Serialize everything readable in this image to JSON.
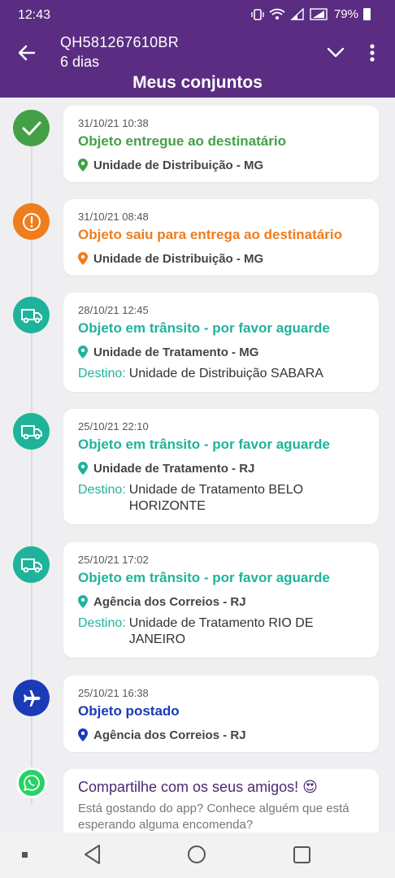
{
  "status_bar": {
    "time": "12:43",
    "battery": "79%"
  },
  "header": {
    "tracking_code": "QH581267610BR",
    "days": "6 dias",
    "title": "Meus conjuntos"
  },
  "colors": {
    "purple": "#5a2d82",
    "green": "#43a047",
    "orange": "#ef7d1c",
    "teal": "#1fb39b",
    "blue": "#1a3bb8",
    "whatsapp": "#25d366"
  },
  "destination_label": "Destino:",
  "events": [
    {
      "date": "31/10/21 10:38",
      "status": "Objeto entregue ao destinatário",
      "location": "Unidade de Distribuição - MG",
      "icon": "check-icon"
    },
    {
      "date": "31/10/21 08:48",
      "status": "Objeto saiu para entrega ao destinatário",
      "location": "Unidade de Distribuição - MG",
      "icon": "alert-icon"
    },
    {
      "date": "28/10/21 12:45",
      "status": "Objeto em trânsito - por favor aguarde",
      "location": "Unidade de Tratamento - MG",
      "destination": "Unidade de Distribuição SABARA",
      "icon": "truck-icon"
    },
    {
      "date": "25/10/21 22:10",
      "status": "Objeto em trânsito - por favor aguarde",
      "location": "Unidade de Tratamento - RJ",
      "destination": "Unidade de Tratamento BELO HORIZONTE",
      "icon": "truck-icon"
    },
    {
      "date": "25/10/21 17:02",
      "status": "Objeto em trânsito - por favor aguarde",
      "location": "Agência dos Correios - RJ",
      "destination": "Unidade de Tratamento RIO DE JANEIRO",
      "icon": "truck-icon"
    },
    {
      "date": "25/10/21 16:38",
      "status": "Objeto postado",
      "location": "Agência dos Correios - RJ",
      "icon": "airplane-icon"
    }
  ],
  "share": {
    "title": "Compartilhe com os seus amigos! 😍",
    "text": "Está gostando do app? Conhece alguém que está esperando alguma encomenda?"
  }
}
